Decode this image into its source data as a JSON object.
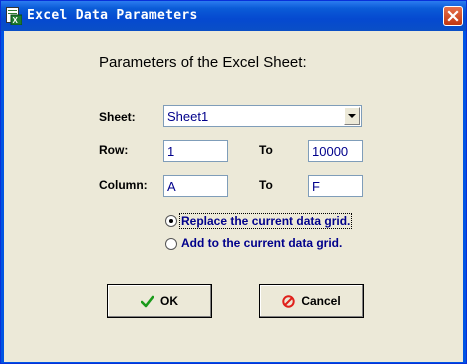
{
  "window": {
    "title": "Excel Data Parameters"
  },
  "heading": "Parameters of the Excel Sheet:",
  "sheet": {
    "label": "Sheet:",
    "value": "Sheet1"
  },
  "row": {
    "label": "Row:",
    "from": "1",
    "to_label": "To",
    "to": "10000"
  },
  "column": {
    "label": "Column:",
    "from": "A",
    "to_label": "To",
    "to": "F"
  },
  "options": {
    "replace": {
      "label": "Replace the current data grid.",
      "selected": true
    },
    "add": {
      "label": "Add to the current data grid.",
      "selected": false
    }
  },
  "buttons": {
    "ok": "OK",
    "cancel": "Cancel"
  },
  "icons": {
    "app": "excel-app-icon",
    "close": "close-icon",
    "dropdown": "chevron-down-icon",
    "ok": "check-icon",
    "cancel": "cancel-icon"
  },
  "colors": {
    "title_bar": "#0549d0",
    "face": "#ece9d8",
    "value_text": "#00008b",
    "ok_check": "#1a9a1a",
    "cancel_icon": "#e0201b"
  }
}
